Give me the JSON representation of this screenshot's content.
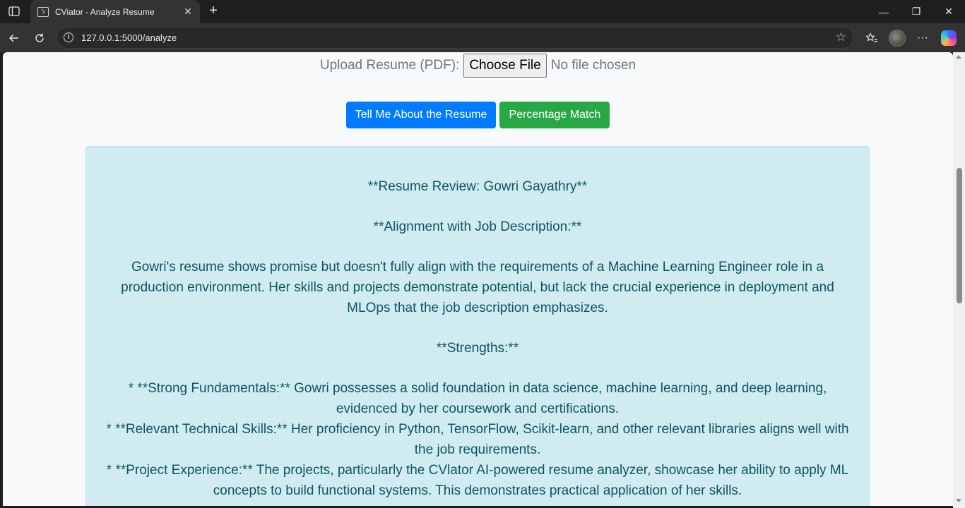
{
  "browser": {
    "tab_title": "CViator - Analyze Resume",
    "new_tab_icon": "+",
    "url": "127.0.0.1:5000/analyze",
    "window_controls": {
      "minimize": "—",
      "maximize": "❐",
      "close": "✕"
    }
  },
  "upload": {
    "label": "Upload Resume (PDF):",
    "button_label": "Choose File",
    "status": "No file chosen"
  },
  "actions": {
    "about_label": "Tell Me About the Resume",
    "match_label": "Percentage Match",
    "about_color": "#007bff",
    "match_color": "#28a745"
  },
  "result": {
    "title": "**Resume Review: Gowri Gayathry**",
    "alignment_heading": "**Alignment with Job Description:**",
    "alignment_text": "Gowri's resume shows promise but doesn't fully align with the requirements of a Machine Learning Engineer role in a production environment. Her skills and projects demonstrate potential, but lack the crucial experience in deployment and MLOps that the job description emphasizes.",
    "strengths_heading": "**Strengths:**",
    "strengths": [
      "* **Strong Fundamentals:** Gowri possesses a solid foundation in data science, machine learning, and deep learning, evidenced by her coursework and certifications.",
      "* **Relevant Technical Skills:** Her proficiency in Python, TensorFlow, Scikit-learn, and other relevant libraries aligns well with the job requirements.",
      "* **Project Experience:** The projects, particularly the CVlator AI-powered resume analyzer, showcase her ability to apply ML concepts to build functional systems. This demonstrates practical application of her skills."
    ]
  }
}
